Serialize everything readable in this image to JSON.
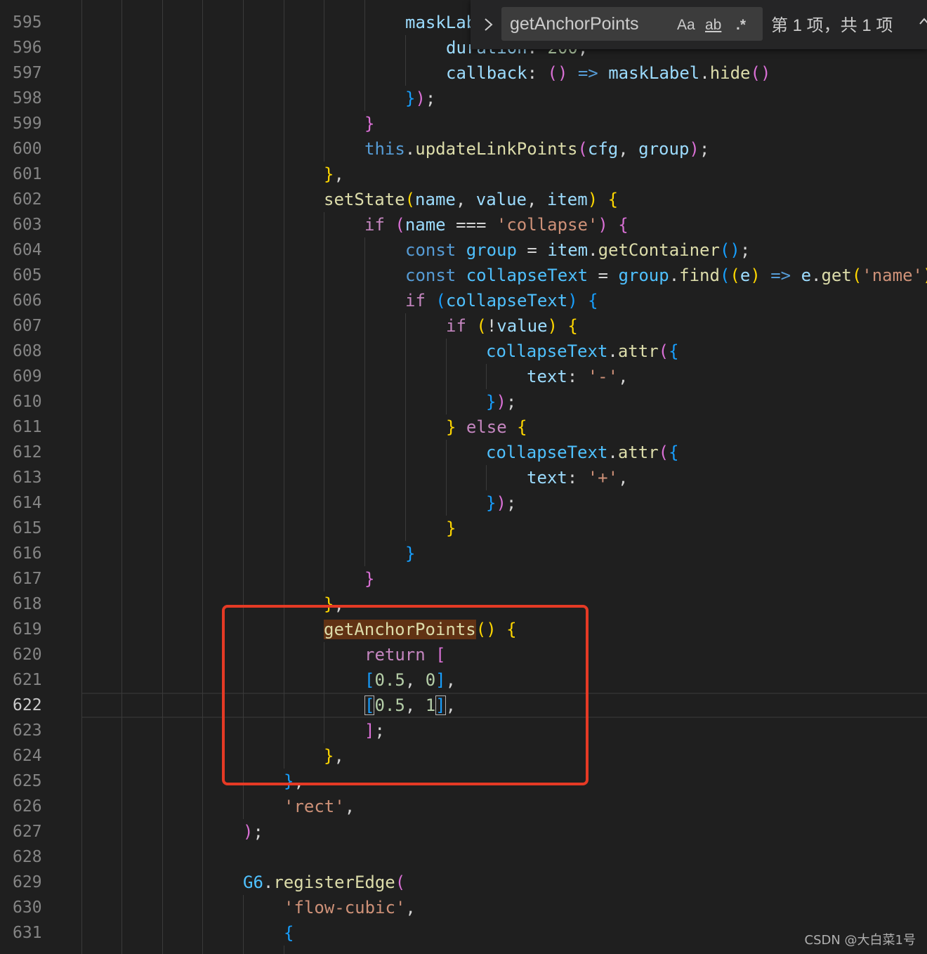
{
  "editor": {
    "line_numbers": [
      "595",
      "596",
      "597",
      "598",
      "599",
      "600",
      "601",
      "602",
      "603",
      "604",
      "605",
      "606",
      "607",
      "608",
      "609",
      "610",
      "611",
      "612",
      "613",
      "614",
      "615",
      "616",
      "617",
      "618",
      "619",
      "620",
      "621",
      "622",
      "623",
      "624",
      "625",
      "626",
      "627",
      "628",
      "629",
      "630",
      "631"
    ],
    "active_line": "622",
    "code": {
      "l595": "maskLabel",
      "l596_key": "duration",
      "l596_val": "200",
      "l597_key": "callback",
      "l597_obj": "maskLabel",
      "l597_fn": "hide",
      "l600_this": "this",
      "l600_fn": "updateLinkPoints",
      "l600_a": "cfg",
      "l600_b": "group",
      "l602_fn": "setState",
      "l602_a": "name",
      "l602_b": "value",
      "l602_c": "item",
      "l603_kw": "if",
      "l603_var": "name",
      "l603_op": "===",
      "l603_str": "'collapse'",
      "l604_kw": "const",
      "l604_var": "group",
      "l604_obj": "item",
      "l604_fn": "getContainer",
      "l605_kw": "const",
      "l605_var": "collapseText",
      "l605_obj": "group",
      "l605_fn": "find",
      "l605_e": "e",
      "l605_get": "get",
      "l605_str": "'name'",
      "l606_kw": "if",
      "l606_var": "collapseText",
      "l607_kw": "if",
      "l607_var": "value",
      "l608_obj": "collapseText",
      "l608_fn": "attr",
      "l609_key": "text",
      "l609_str": "'-'",
      "l611_kw": "else",
      "l612_obj": "collapseText",
      "l612_fn": "attr",
      "l613_key": "text",
      "l613_str": "'+'",
      "l619_fn": "getAnchorPoints",
      "l620_kw": "return",
      "l621_a": "0.5",
      "l621_b": "0",
      "l622_a": "0.5",
      "l622_b": "1",
      "l626_str": "'rect'",
      "l629_obj": "G6",
      "l629_fn": "registerEdge",
      "l630_str": "'flow-cubic'"
    }
  },
  "find": {
    "query": "getAnchorPoints",
    "match_case": "Aa",
    "whole_word": "ab",
    "regex": ".*",
    "result": "第 1 项，共 1 项"
  },
  "watermark": "CSDN @大白菜1号",
  "colors": {
    "annotation": "#e53a25",
    "match_highlight": "#613214"
  }
}
